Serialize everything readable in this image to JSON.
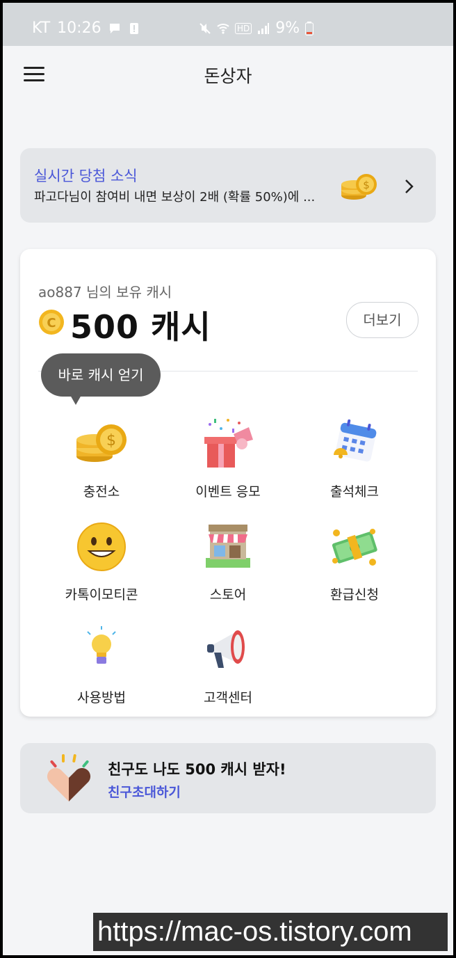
{
  "status_bar": {
    "carrier": "KT",
    "time": "10:26",
    "battery": "9%",
    "hd": "HD"
  },
  "header": {
    "title": "돈상자"
  },
  "notice": {
    "title": "실시간 당첨 소식",
    "text": "파고다님이 참여비 내면 보상이 2배 (확률 50%)에 ..."
  },
  "wallet": {
    "owner_label": "ao887 님의 보유 캐시",
    "amount": "500 캐시",
    "more_label": "더보기",
    "tooltip": "바로 캐시 얻기"
  },
  "menu_items": [
    {
      "label": "충전소",
      "icon": "coins-icon"
    },
    {
      "label": "이벤트 응모",
      "icon": "gift-box-icon"
    },
    {
      "label": "출석체크",
      "icon": "calendar-icon"
    },
    {
      "label": "카톡이모티콘",
      "icon": "smiley-icon"
    },
    {
      "label": "스토어",
      "icon": "store-icon"
    },
    {
      "label": "환급신청",
      "icon": "money-icon"
    },
    {
      "label": "사용방법",
      "icon": "lightbulb-icon"
    },
    {
      "label": "고객센터",
      "icon": "megaphone-icon"
    }
  ],
  "invite": {
    "title": "친구도 나도 500 캐시 받자!",
    "link": "친구초대하기"
  },
  "watermark": "https://mac-os.tistory.com",
  "colors": {
    "accent": "#4a57d8",
    "coin": "#f2b61f",
    "tooltip": "#5b5b5b"
  }
}
